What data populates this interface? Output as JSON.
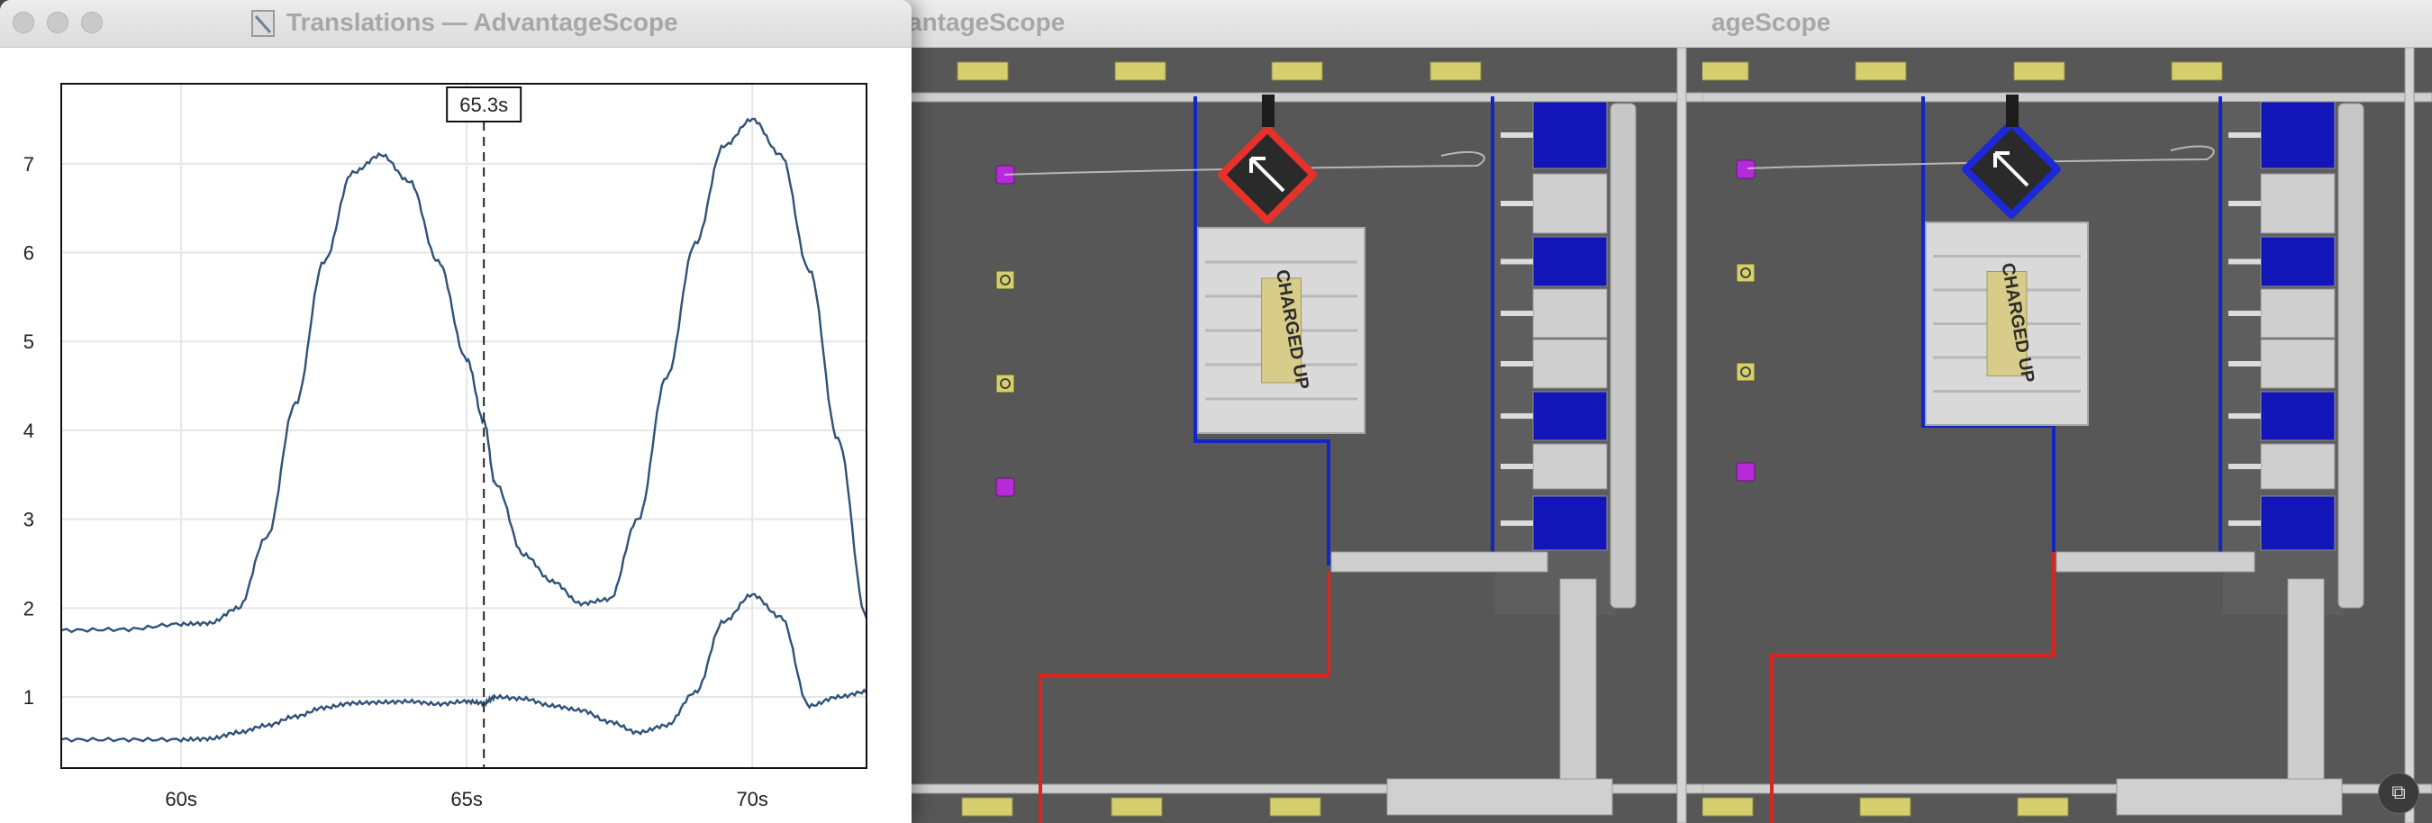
{
  "windows": {
    "main": {
      "title": "Translations — AdvantageScope"
    },
    "field1": {
      "title_visible": "antageScope"
    },
    "field2": {
      "title_visible": "ageScope"
    }
  },
  "chart_data": {
    "type": "line",
    "x_unit": "s",
    "xlim": [
      57.9,
      72.0
    ],
    "ylim": [
      0.2,
      7.9
    ],
    "x_ticks": [
      60,
      65,
      70
    ],
    "x_tick_labels": [
      "60s",
      "65s",
      "70s"
    ],
    "y_ticks": [
      1,
      2,
      3,
      4,
      5,
      6,
      7
    ],
    "y_tick_labels": [
      "1",
      "2",
      "3",
      "4",
      "5",
      "6",
      "7"
    ],
    "grid": true,
    "cursor": {
      "x": 65.3,
      "label": "65.3s"
    },
    "series": [
      {
        "color": "#2f5279",
        "x": [
          57.9,
          59.0,
          60.0,
          60.5,
          61.0,
          61.5,
          62.0,
          62.5,
          63.0,
          63.5,
          64.0,
          64.5,
          65.0,
          65.3,
          65.5,
          66.0,
          66.5,
          67.0,
          67.5,
          68.0,
          68.5,
          69.0,
          69.5,
          70.0,
          70.5,
          71.0,
          71.5,
          72.0
        ],
        "y": [
          1.75,
          1.76,
          1.82,
          1.83,
          2.0,
          2.8,
          4.3,
          5.9,
          6.9,
          7.1,
          6.8,
          5.9,
          4.8,
          4.1,
          3.4,
          2.6,
          2.3,
          2.05,
          2.1,
          3.0,
          4.6,
          6.1,
          7.2,
          7.5,
          7.1,
          5.8,
          3.9,
          1.9
        ]
      },
      {
        "color": "#2f5279",
        "x": [
          57.9,
          59.0,
          60.0,
          60.5,
          61.0,
          61.5,
          62.0,
          62.5,
          63.0,
          63.5,
          64.0,
          64.5,
          65.0,
          65.3,
          65.5,
          66.0,
          66.5,
          67.0,
          67.5,
          68.0,
          68.5,
          69.0,
          69.5,
          70.0,
          70.5,
          71.0,
          71.5,
          72.0
        ],
        "y": [
          0.52,
          0.52,
          0.52,
          0.53,
          0.6,
          0.68,
          0.78,
          0.88,
          0.93,
          0.94,
          0.95,
          0.92,
          0.95,
          0.93,
          1.0,
          0.98,
          0.9,
          0.85,
          0.72,
          0.6,
          0.68,
          1.05,
          1.85,
          2.15,
          1.9,
          0.9,
          1.0,
          1.06
        ]
      }
    ]
  },
  "field": {
    "game_logo": "CHARGED UP",
    "robot1_bumper_color": "#e8312a",
    "robot2_bumper_color": "#1d28d6",
    "alliance_blue": "#1126c7",
    "alliance_red": "#d9241f",
    "cone_color": "#d6cf6e",
    "cube_color": "#b72ad9"
  }
}
